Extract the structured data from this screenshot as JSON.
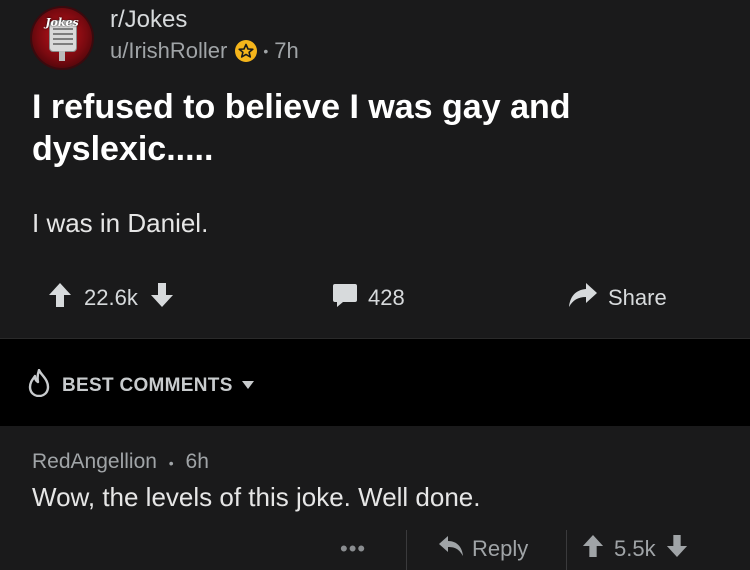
{
  "post": {
    "subreddit": "r/Jokes",
    "username": "u/IrishRoller",
    "time": "7h",
    "separator": "•",
    "title": "I refused to believe I was gay and dyslexic.....",
    "body": "I was in Daniel.",
    "score": "22.6k",
    "comments_count": "428",
    "share_label": "Share",
    "avatar_logo_text": "Jokes"
  },
  "sort": {
    "label": "BEST COMMENTS"
  },
  "comment": {
    "author": "RedAngellion",
    "separator": "•",
    "time": "6h",
    "body": "Wow, the levels of this joke. Well done.",
    "more": "•••",
    "reply_label": "Reply",
    "score": "5.5k"
  },
  "colors": {
    "background": "#1a1a1b",
    "sort_bar": "#000000",
    "badge": "#f5b51b",
    "text_primary": "#ffffff",
    "text_muted": "#a0a4a7"
  },
  "icons": {
    "avatar": "subreddit-avatar",
    "badge": "star-badge-icon",
    "upvote": "upvote-arrow-icon",
    "downvote": "downvote-arrow-icon",
    "comment": "comment-bubble-icon",
    "share": "share-arrow-icon",
    "sort": "flame-icon",
    "caret": "chevron-down-icon",
    "reply": "reply-arrow-icon"
  }
}
